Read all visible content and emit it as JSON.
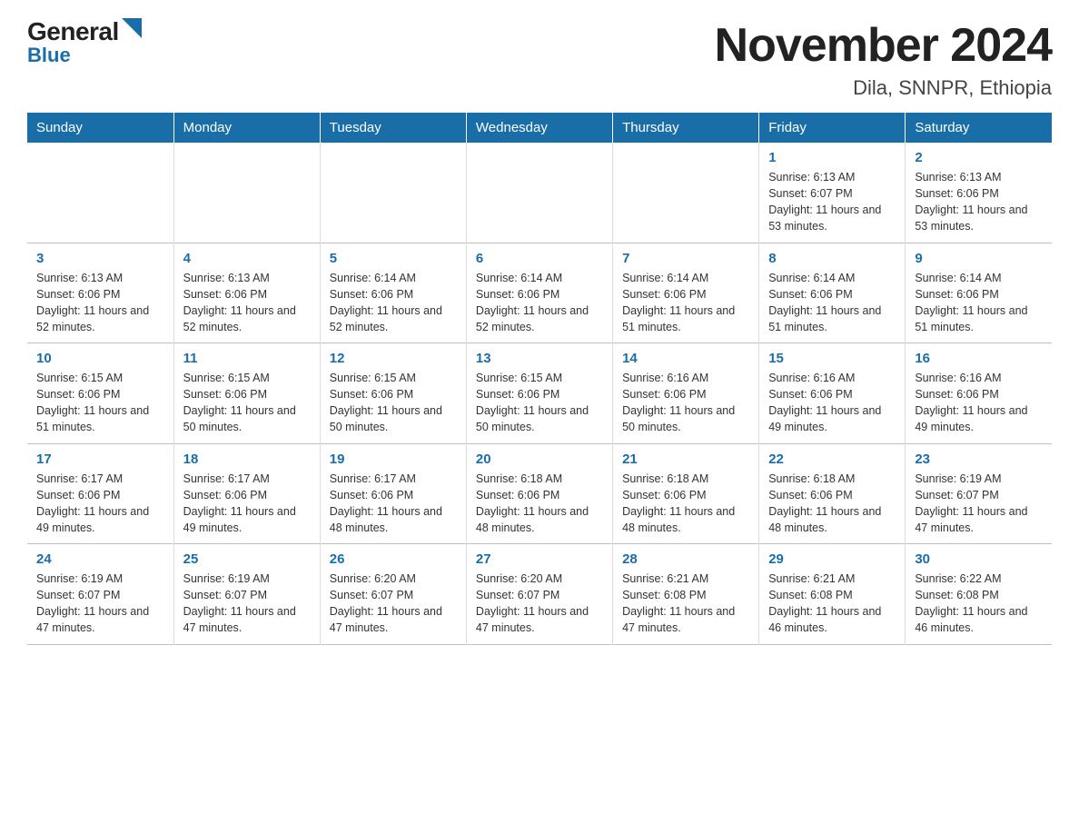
{
  "logo": {
    "general": "General",
    "blue": "Blue"
  },
  "title": "November 2024",
  "subtitle": "Dila, SNNPR, Ethiopia",
  "days_of_week": [
    "Sunday",
    "Monday",
    "Tuesday",
    "Wednesday",
    "Thursday",
    "Friday",
    "Saturday"
  ],
  "weeks": [
    [
      {
        "day": "",
        "info": ""
      },
      {
        "day": "",
        "info": ""
      },
      {
        "day": "",
        "info": ""
      },
      {
        "day": "",
        "info": ""
      },
      {
        "day": "",
        "info": ""
      },
      {
        "day": "1",
        "info": "Sunrise: 6:13 AM\nSunset: 6:07 PM\nDaylight: 11 hours and 53 minutes."
      },
      {
        "day": "2",
        "info": "Sunrise: 6:13 AM\nSunset: 6:06 PM\nDaylight: 11 hours and 53 minutes."
      }
    ],
    [
      {
        "day": "3",
        "info": "Sunrise: 6:13 AM\nSunset: 6:06 PM\nDaylight: 11 hours and 52 minutes."
      },
      {
        "day": "4",
        "info": "Sunrise: 6:13 AM\nSunset: 6:06 PM\nDaylight: 11 hours and 52 minutes."
      },
      {
        "day": "5",
        "info": "Sunrise: 6:14 AM\nSunset: 6:06 PM\nDaylight: 11 hours and 52 minutes."
      },
      {
        "day": "6",
        "info": "Sunrise: 6:14 AM\nSunset: 6:06 PM\nDaylight: 11 hours and 52 minutes."
      },
      {
        "day": "7",
        "info": "Sunrise: 6:14 AM\nSunset: 6:06 PM\nDaylight: 11 hours and 51 minutes."
      },
      {
        "day": "8",
        "info": "Sunrise: 6:14 AM\nSunset: 6:06 PM\nDaylight: 11 hours and 51 minutes."
      },
      {
        "day": "9",
        "info": "Sunrise: 6:14 AM\nSunset: 6:06 PM\nDaylight: 11 hours and 51 minutes."
      }
    ],
    [
      {
        "day": "10",
        "info": "Sunrise: 6:15 AM\nSunset: 6:06 PM\nDaylight: 11 hours and 51 minutes."
      },
      {
        "day": "11",
        "info": "Sunrise: 6:15 AM\nSunset: 6:06 PM\nDaylight: 11 hours and 50 minutes."
      },
      {
        "day": "12",
        "info": "Sunrise: 6:15 AM\nSunset: 6:06 PM\nDaylight: 11 hours and 50 minutes."
      },
      {
        "day": "13",
        "info": "Sunrise: 6:15 AM\nSunset: 6:06 PM\nDaylight: 11 hours and 50 minutes."
      },
      {
        "day": "14",
        "info": "Sunrise: 6:16 AM\nSunset: 6:06 PM\nDaylight: 11 hours and 50 minutes."
      },
      {
        "day": "15",
        "info": "Sunrise: 6:16 AM\nSunset: 6:06 PM\nDaylight: 11 hours and 49 minutes."
      },
      {
        "day": "16",
        "info": "Sunrise: 6:16 AM\nSunset: 6:06 PM\nDaylight: 11 hours and 49 minutes."
      }
    ],
    [
      {
        "day": "17",
        "info": "Sunrise: 6:17 AM\nSunset: 6:06 PM\nDaylight: 11 hours and 49 minutes."
      },
      {
        "day": "18",
        "info": "Sunrise: 6:17 AM\nSunset: 6:06 PM\nDaylight: 11 hours and 49 minutes."
      },
      {
        "day": "19",
        "info": "Sunrise: 6:17 AM\nSunset: 6:06 PM\nDaylight: 11 hours and 48 minutes."
      },
      {
        "day": "20",
        "info": "Sunrise: 6:18 AM\nSunset: 6:06 PM\nDaylight: 11 hours and 48 minutes."
      },
      {
        "day": "21",
        "info": "Sunrise: 6:18 AM\nSunset: 6:06 PM\nDaylight: 11 hours and 48 minutes."
      },
      {
        "day": "22",
        "info": "Sunrise: 6:18 AM\nSunset: 6:06 PM\nDaylight: 11 hours and 48 minutes."
      },
      {
        "day": "23",
        "info": "Sunrise: 6:19 AM\nSunset: 6:07 PM\nDaylight: 11 hours and 47 minutes."
      }
    ],
    [
      {
        "day": "24",
        "info": "Sunrise: 6:19 AM\nSunset: 6:07 PM\nDaylight: 11 hours and 47 minutes."
      },
      {
        "day": "25",
        "info": "Sunrise: 6:19 AM\nSunset: 6:07 PM\nDaylight: 11 hours and 47 minutes."
      },
      {
        "day": "26",
        "info": "Sunrise: 6:20 AM\nSunset: 6:07 PM\nDaylight: 11 hours and 47 minutes."
      },
      {
        "day": "27",
        "info": "Sunrise: 6:20 AM\nSunset: 6:07 PM\nDaylight: 11 hours and 47 minutes."
      },
      {
        "day": "28",
        "info": "Sunrise: 6:21 AM\nSunset: 6:08 PM\nDaylight: 11 hours and 47 minutes."
      },
      {
        "day": "29",
        "info": "Sunrise: 6:21 AM\nSunset: 6:08 PM\nDaylight: 11 hours and 46 minutes."
      },
      {
        "day": "30",
        "info": "Sunrise: 6:22 AM\nSunset: 6:08 PM\nDaylight: 11 hours and 46 minutes."
      }
    ]
  ]
}
